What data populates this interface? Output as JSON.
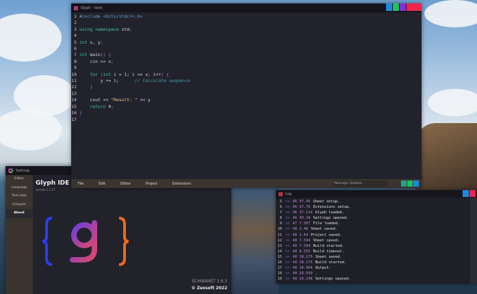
{
  "editor": {
    "title": "Glyph - tests",
    "window_buttons": [
      "#1e88e5",
      "#1ec25a",
      "#8a2be2",
      "#f0244f"
    ],
    "lines": [
      [
        [
          "pp",
          "#include <bits/stdc++.h>"
        ]
      ],
      [],
      [
        [
          "kw",
          "using namespace "
        ],
        [
          "tx",
          "std"
        ],
        [
          "pn",
          ";"
        ]
      ],
      [],
      [
        [
          "ty",
          "int "
        ],
        [
          "tx",
          "x, y"
        ],
        [
          "pn",
          ";"
        ]
      ],
      [],
      [
        [
          "ty",
          "int "
        ],
        [
          "tx",
          "main"
        ],
        [
          "pn",
          "() {"
        ]
      ],
      [
        [
          "tx",
          "    cin >> x"
        ],
        [
          "pn",
          ";"
        ]
      ],
      [],
      [
        [
          "kw",
          "    for "
        ],
        [
          "pn",
          "("
        ],
        [
          "ty",
          "int "
        ],
        [
          "tx",
          "i = 1; i <= x; i++"
        ],
        [
          "pn",
          ") {"
        ]
      ],
      [
        [
          "tx",
          "        y += i;"
        ],
        [
          "cm",
          "      // Calculate sequence"
        ]
      ],
      [
        [
          "pn",
          "    }"
        ]
      ],
      [],
      [
        [
          "tx",
          "    cout << "
        ],
        [
          "st",
          "\"Result: \""
        ],
        [
          "tx",
          " << y"
        ]
      ],
      [
        [
          "kw",
          "    return "
        ],
        [
          "tx",
          "0"
        ],
        [
          "pn",
          ";"
        ]
      ],
      [
        [
          "pn",
          "}"
        ]
      ],
      []
    ],
    "menu": [
      "File",
      "Edit",
      "Editor",
      "Project",
      "Extensions"
    ],
    "status": "Message: Updates",
    "status_buttons": [
      "#1aa88a",
      "#1ec25a",
      "#1e88e5"
    ]
  },
  "settings": {
    "title": "Settings",
    "sidebar": [
      "Editor",
      "Language",
      "Text view",
      "Compiler",
      "About"
    ],
    "active": "About",
    "app_name": "Glyph IDE",
    "version": "version 1.1.17",
    "product": "SCHIBANET 3.6.3",
    "copyright": "© Zexsoft 2022",
    "logo_text": "{ g }"
  },
  "log": {
    "title": "Log",
    "window_buttons": [
      "#1e88e5",
      "#f0244f"
    ],
    "rows": [
      [
        "5",
        ">>",
        "46 37.45",
        "Sheet setup."
      ],
      [
        "6",
        ">>",
        "46 37.76",
        "Extensions setup."
      ],
      [
        "7",
        ">>",
        "46 37.114",
        "Glyph loaded."
      ],
      [
        "8",
        ">>",
        "46 43.18",
        "Settings opened."
      ],
      [
        "9",
        ">>",
        "47 7.507",
        "File loaded."
      ],
      [
        "10",
        ">>",
        "48 2.48",
        "Sheet saved."
      ],
      [
        "11",
        ">>",
        "48 2.64",
        "Project saved."
      ],
      [
        "12",
        ">>",
        "48 7.594",
        "Sheet saved."
      ],
      [
        "13",
        ">>",
        "48 7.594",
        "Build started."
      ],
      [
        "14",
        ">>",
        "48 8.555",
        "Build timeout."
      ],
      [
        "15",
        ">>",
        "48 18.175",
        "Sheet saved."
      ],
      [
        "16",
        ">>",
        "48 18.175",
        "Build started."
      ],
      [
        "17",
        ">>",
        "48 18.904",
        "Output:"
      ],
      [
        "18",
        ">>",
        "48 28.590",
        "."
      ],
      [
        "19",
        ">>",
        "48 29.248",
        "Settings opened."
      ]
    ]
  }
}
